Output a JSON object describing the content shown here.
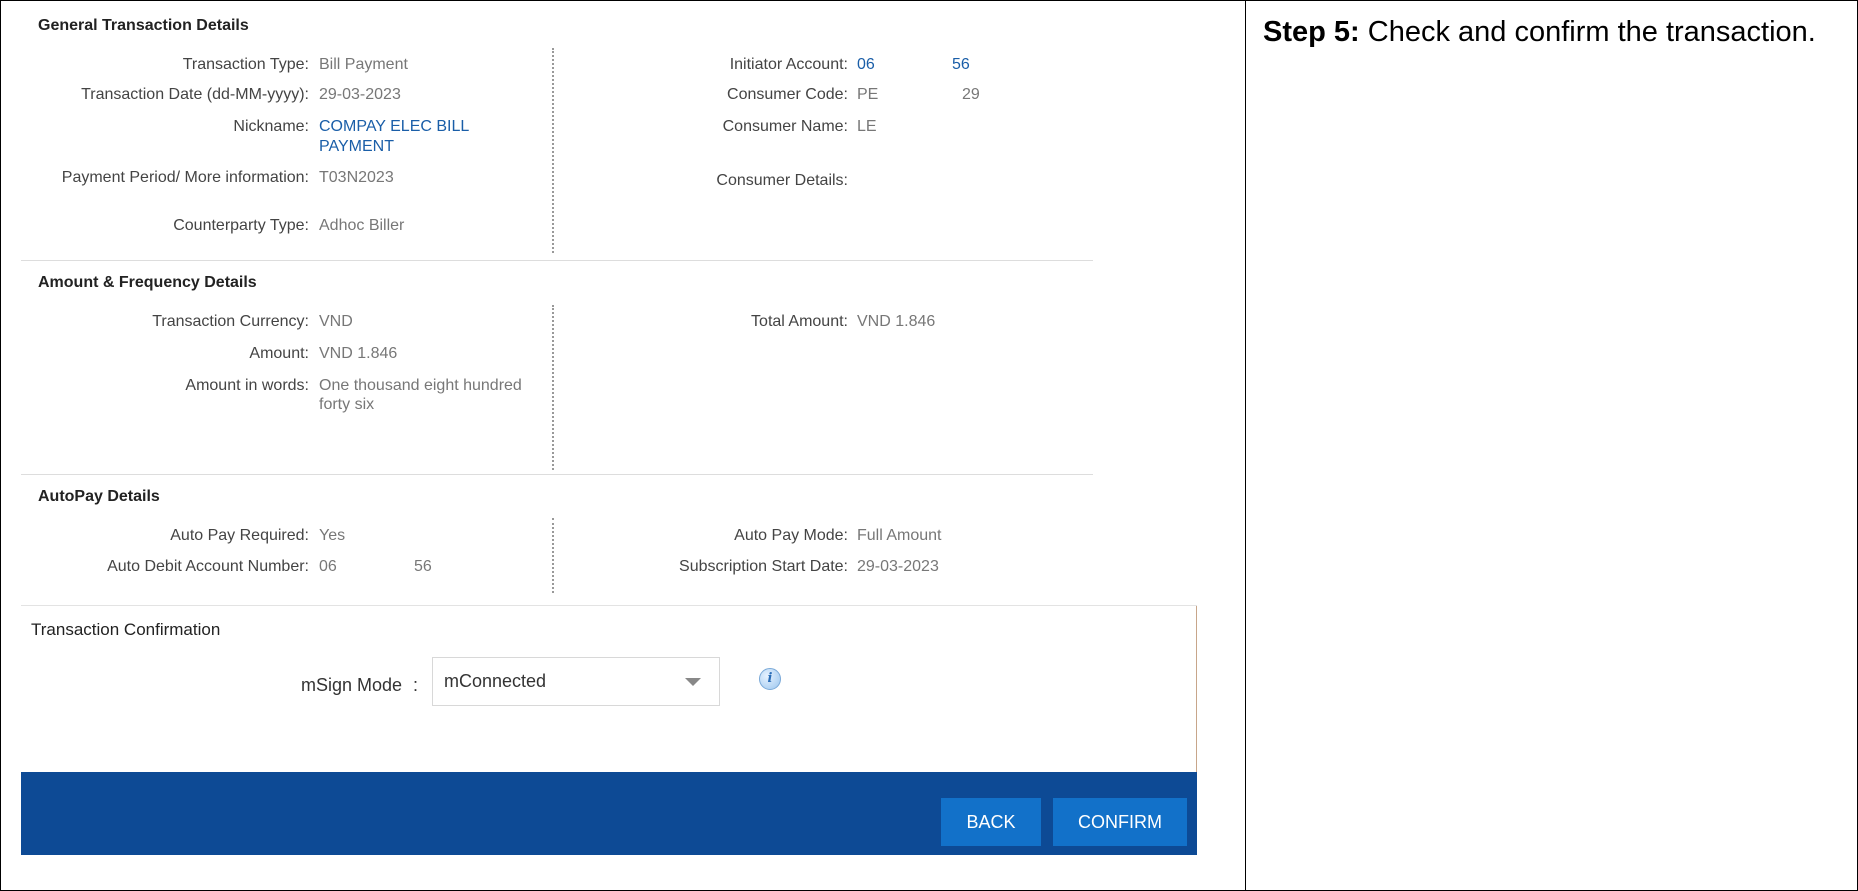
{
  "note": {
    "step_label": "Step 5:",
    "text": " Check and confirm the transaction."
  },
  "general": {
    "title": "General Transaction Details",
    "left": [
      {
        "label": "Transaction Type:",
        "value": "Bill Payment"
      },
      {
        "label": "Transaction Date (dd-MM-yyyy):",
        "value": "29-03-2023"
      },
      {
        "label": "Nickname:",
        "value": "COMPAY ELEC BILL",
        "value2": "PAYMENT"
      },
      {
        "label": "Payment Period/ More information:",
        "value": "T03N2023"
      },
      {
        "label": "Counterparty Type:",
        "value": "Adhoc Biller"
      }
    ],
    "right": [
      {
        "label": "Initiator Account:",
        "value": "06",
        "value_tail": "56"
      },
      {
        "label": "Consumer Code:",
        "value": "PE",
        "value_tail": "29"
      },
      {
        "label": "Consumer Name:",
        "value": "LE"
      },
      {
        "label": "Consumer Details:",
        "value": ""
      }
    ]
  },
  "amount": {
    "title": "Amount & Frequency Details",
    "left": [
      {
        "label": "Transaction Currency:",
        "value": "VND"
      },
      {
        "label": "Amount:",
        "value": "VND 1.846"
      },
      {
        "label": "Amount in words:",
        "value": "One thousand eight hundred",
        "value2": "forty six"
      }
    ],
    "right": [
      {
        "label": "Total Amount:",
        "value": "VND 1.846"
      }
    ]
  },
  "autopay": {
    "title": "AutoPay Details",
    "left": [
      {
        "label": "Auto Pay Required:",
        "value": "Yes"
      },
      {
        "label": "Auto Debit Account Number:",
        "value": "06",
        "value_tail": "56"
      }
    ],
    "right": [
      {
        "label": "Auto Pay Mode:",
        "value": "Full Amount"
      },
      {
        "label": "Subscription Start Date:",
        "value": "29-03-2023"
      }
    ]
  },
  "confirmation": {
    "title": "Transaction Confirmation",
    "msign_label": "mSign Mode",
    "colon": ":",
    "msign_value": "mConnected",
    "info_glyph": "i"
  },
  "footer": {
    "back_label": "BACK",
    "confirm_label": "CONFIRM",
    "bar_color": "#0d4a95",
    "button_color": "#1271c9"
  }
}
